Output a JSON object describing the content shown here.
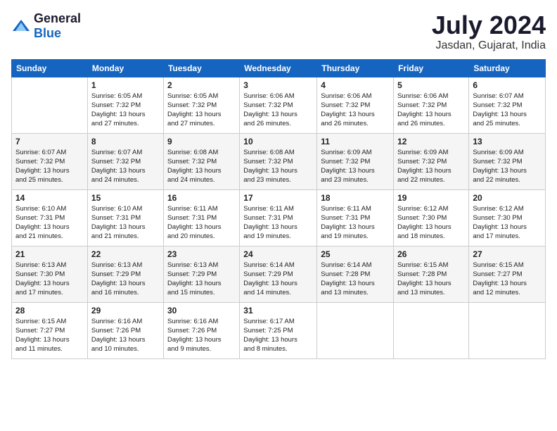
{
  "header": {
    "logo_general": "General",
    "logo_blue": "Blue",
    "month_year": "July 2024",
    "location": "Jasdan, Gujarat, India"
  },
  "weekdays": [
    "Sunday",
    "Monday",
    "Tuesday",
    "Wednesday",
    "Thursday",
    "Friday",
    "Saturday"
  ],
  "weeks": [
    [
      {
        "date": "",
        "info": ""
      },
      {
        "date": "1",
        "info": "Sunrise: 6:05 AM\nSunset: 7:32 PM\nDaylight: 13 hours\nand 27 minutes."
      },
      {
        "date": "2",
        "info": "Sunrise: 6:05 AM\nSunset: 7:32 PM\nDaylight: 13 hours\nand 27 minutes."
      },
      {
        "date": "3",
        "info": "Sunrise: 6:06 AM\nSunset: 7:32 PM\nDaylight: 13 hours\nand 26 minutes."
      },
      {
        "date": "4",
        "info": "Sunrise: 6:06 AM\nSunset: 7:32 PM\nDaylight: 13 hours\nand 26 minutes."
      },
      {
        "date": "5",
        "info": "Sunrise: 6:06 AM\nSunset: 7:32 PM\nDaylight: 13 hours\nand 26 minutes."
      },
      {
        "date": "6",
        "info": "Sunrise: 6:07 AM\nSunset: 7:32 PM\nDaylight: 13 hours\nand 25 minutes."
      }
    ],
    [
      {
        "date": "7",
        "info": "Sunrise: 6:07 AM\nSunset: 7:32 PM\nDaylight: 13 hours\nand 25 minutes."
      },
      {
        "date": "8",
        "info": "Sunrise: 6:07 AM\nSunset: 7:32 PM\nDaylight: 13 hours\nand 24 minutes."
      },
      {
        "date": "9",
        "info": "Sunrise: 6:08 AM\nSunset: 7:32 PM\nDaylight: 13 hours\nand 24 minutes."
      },
      {
        "date": "10",
        "info": "Sunrise: 6:08 AM\nSunset: 7:32 PM\nDaylight: 13 hours\nand 23 minutes."
      },
      {
        "date": "11",
        "info": "Sunrise: 6:09 AM\nSunset: 7:32 PM\nDaylight: 13 hours\nand 23 minutes."
      },
      {
        "date": "12",
        "info": "Sunrise: 6:09 AM\nSunset: 7:32 PM\nDaylight: 13 hours\nand 22 minutes."
      },
      {
        "date": "13",
        "info": "Sunrise: 6:09 AM\nSunset: 7:32 PM\nDaylight: 13 hours\nand 22 minutes."
      }
    ],
    [
      {
        "date": "14",
        "info": "Sunrise: 6:10 AM\nSunset: 7:31 PM\nDaylight: 13 hours\nand 21 minutes."
      },
      {
        "date": "15",
        "info": "Sunrise: 6:10 AM\nSunset: 7:31 PM\nDaylight: 13 hours\nand 21 minutes."
      },
      {
        "date": "16",
        "info": "Sunrise: 6:11 AM\nSunset: 7:31 PM\nDaylight: 13 hours\nand 20 minutes."
      },
      {
        "date": "17",
        "info": "Sunrise: 6:11 AM\nSunset: 7:31 PM\nDaylight: 13 hours\nand 19 minutes."
      },
      {
        "date": "18",
        "info": "Sunrise: 6:11 AM\nSunset: 7:31 PM\nDaylight: 13 hours\nand 19 minutes."
      },
      {
        "date": "19",
        "info": "Sunrise: 6:12 AM\nSunset: 7:30 PM\nDaylight: 13 hours\nand 18 minutes."
      },
      {
        "date": "20",
        "info": "Sunrise: 6:12 AM\nSunset: 7:30 PM\nDaylight: 13 hours\nand 17 minutes."
      }
    ],
    [
      {
        "date": "21",
        "info": "Sunrise: 6:13 AM\nSunset: 7:30 PM\nDaylight: 13 hours\nand 17 minutes."
      },
      {
        "date": "22",
        "info": "Sunrise: 6:13 AM\nSunset: 7:29 PM\nDaylight: 13 hours\nand 16 minutes."
      },
      {
        "date": "23",
        "info": "Sunrise: 6:13 AM\nSunset: 7:29 PM\nDaylight: 13 hours\nand 15 minutes."
      },
      {
        "date": "24",
        "info": "Sunrise: 6:14 AM\nSunset: 7:29 PM\nDaylight: 13 hours\nand 14 minutes."
      },
      {
        "date": "25",
        "info": "Sunrise: 6:14 AM\nSunset: 7:28 PM\nDaylight: 13 hours\nand 13 minutes."
      },
      {
        "date": "26",
        "info": "Sunrise: 6:15 AM\nSunset: 7:28 PM\nDaylight: 13 hours\nand 13 minutes."
      },
      {
        "date": "27",
        "info": "Sunrise: 6:15 AM\nSunset: 7:27 PM\nDaylight: 13 hours\nand 12 minutes."
      }
    ],
    [
      {
        "date": "28",
        "info": "Sunrise: 6:15 AM\nSunset: 7:27 PM\nDaylight: 13 hours\nand 11 minutes."
      },
      {
        "date": "29",
        "info": "Sunrise: 6:16 AM\nSunset: 7:26 PM\nDaylight: 13 hours\nand 10 minutes."
      },
      {
        "date": "30",
        "info": "Sunrise: 6:16 AM\nSunset: 7:26 PM\nDaylight: 13 hours\nand 9 minutes."
      },
      {
        "date": "31",
        "info": "Sunrise: 6:17 AM\nSunset: 7:25 PM\nDaylight: 13 hours\nand 8 minutes."
      },
      {
        "date": "",
        "info": ""
      },
      {
        "date": "",
        "info": ""
      },
      {
        "date": "",
        "info": ""
      }
    ]
  ]
}
